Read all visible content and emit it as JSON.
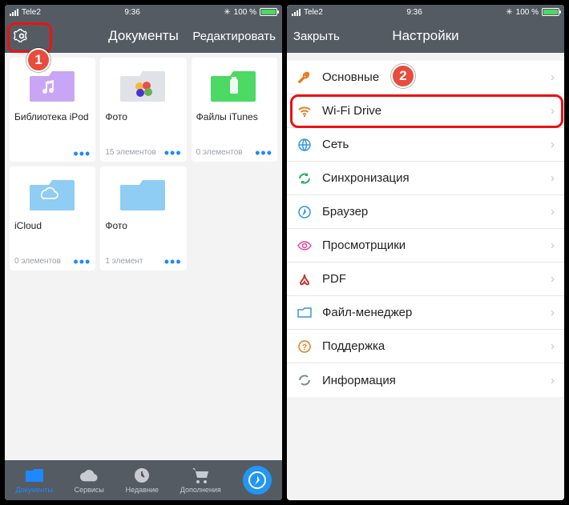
{
  "status": {
    "carrier": "Tele2",
    "time": "9:36",
    "battery": "100 %",
    "bluetooth": "✱"
  },
  "screenA": {
    "title": "Документы",
    "edit": "Редактировать",
    "folders": [
      {
        "name": "Библиотека iPod",
        "sub": "",
        "icon": "music"
      },
      {
        "name": "Фото",
        "sub": "15 элементов",
        "icon": "photos"
      },
      {
        "name": "Файлы iTunes",
        "sub": "0 элементов",
        "icon": "usb"
      },
      {
        "name": "iCloud",
        "sub": "0 элементов",
        "icon": "cloud"
      },
      {
        "name": "Фото",
        "sub": "1 элемент",
        "icon": "plain"
      }
    ],
    "tabs": [
      {
        "id": "documents",
        "label": "Документы"
      },
      {
        "id": "services",
        "label": "Сервисы"
      },
      {
        "id": "recent",
        "label": "Недавние"
      },
      {
        "id": "addons",
        "label": "Дополнения"
      },
      {
        "id": "browser",
        "label": ""
      }
    ]
  },
  "screenB": {
    "close": "Закрыть",
    "title": "Настройки",
    "items": [
      {
        "id": "general",
        "label": "Основные",
        "icon": "wrench",
        "color": "#e67e22"
      },
      {
        "id": "wifi",
        "label": "Wi-Fi Drive",
        "icon": "wifi",
        "color": "#e67e22"
      },
      {
        "id": "network",
        "label": "Сеть",
        "icon": "globe",
        "color": "#3498db"
      },
      {
        "id": "sync",
        "label": "Синхронизация",
        "icon": "refresh",
        "color": "#27ae60"
      },
      {
        "id": "browser",
        "label": "Браузер",
        "icon": "compass",
        "color": "#3498db"
      },
      {
        "id": "viewers",
        "label": "Просмотрщики",
        "icon": "eye",
        "color": "#e84393"
      },
      {
        "id": "pdf",
        "label": "PDF",
        "icon": "pdf",
        "color": "#c0392b"
      },
      {
        "id": "filemgr",
        "label": "Файл-менеджер",
        "icon": "folder",
        "color": "#3498db"
      },
      {
        "id": "support",
        "label": "Поддержка",
        "icon": "question",
        "color": "#e67e22"
      },
      {
        "id": "info",
        "label": "Информация",
        "icon": "refresh",
        "color": "#7f8c8d"
      }
    ]
  },
  "callouts": {
    "one": "1",
    "two": "2"
  }
}
